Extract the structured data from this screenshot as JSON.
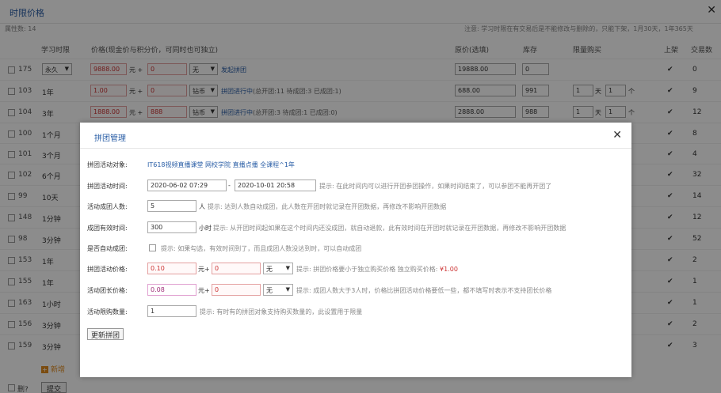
{
  "window": {
    "title": "时限价格"
  },
  "subbar": {
    "count": "属性数: 14",
    "note": "注意: 学习时限在有交易后是不能修改与删除的，只能下架，1月30天，1年365天"
  },
  "header": {
    "duration": "学习时限",
    "price": "价格(现金价与积分价，可同时也可独立)",
    "original": "原价(选填)",
    "stock": "库存",
    "limit": "限量购买",
    "listed": "上架",
    "sales": "交易数"
  },
  "rows": [
    {
      "id": "175",
      "duration_select": "永久",
      "cash": "9888.00",
      "points": "0",
      "points_type": "无",
      "link": "发起拼团",
      "link_extra": "",
      "original": "19888.00",
      "stock": "0",
      "limit_day": "",
      "limit_qty": "",
      "sales": "0"
    },
    {
      "id": "103",
      "duration": "1年",
      "cash": "1.00",
      "points": "0",
      "points_type": "钻币",
      "link": "拼团进行中",
      "link_extra": "(总开团:11 待成团:3 已成团:1)",
      "original": "688.00",
      "stock": "991",
      "limit_day": "1",
      "limit_qty": "1",
      "sales": "9"
    },
    {
      "id": "104",
      "duration": "3年",
      "cash": "1888.00",
      "points": "888",
      "points_type": "钻币",
      "link": "拼团进行中",
      "link_extra": "(总开团:3 待成团:1 已成团:0)",
      "original": "2888.00",
      "stock": "988",
      "limit_day": "1",
      "limit_qty": "1",
      "sales": "12"
    },
    {
      "id": "100",
      "duration": "1个月",
      "sales": "8"
    },
    {
      "id": "101",
      "duration": "3个月",
      "sales": "4"
    },
    {
      "id": "102",
      "duration": "6个月",
      "sales": "32"
    },
    {
      "id": "99",
      "duration": "10天",
      "sales": "14"
    },
    {
      "id": "148",
      "duration": "1分钟",
      "sales": "12"
    },
    {
      "id": "98",
      "duration": "3分钟",
      "sales": "52"
    },
    {
      "id": "153",
      "duration": "1年",
      "sales": "2"
    },
    {
      "id": "155",
      "duration": "1年",
      "sales": "1"
    },
    {
      "id": "163",
      "duration": "1小时",
      "sales": "1"
    },
    {
      "id": "156",
      "duration": "3分钟",
      "sales": "2"
    },
    {
      "id": "159",
      "duration": "3分钟",
      "sales": "3"
    }
  ],
  "common": {
    "yuan_plus": "元 +",
    "day": "天",
    "unit": "个",
    "check": "✔"
  },
  "add_label": "新增",
  "footer": {
    "delete": "删?",
    "submit": "提交"
  },
  "modal": {
    "title": "拼团管理",
    "object_label": "拼团活动对象:",
    "object_value": "IT618视频直播课堂 网校学院 直播点播 全课程^1年",
    "time_label": "拼团活动时间:",
    "time_start": "2020-06-02 07:29",
    "time_sep": "-",
    "time_end": "2020-10-01 20:58",
    "time_tip": "提示: 在此时间内可以进行开团参团操作，如果时间结束了，可以参团不能再开团了",
    "people_label": "活动成团人数:",
    "people_value": "5",
    "people_unit": "人",
    "people_tip": "提示: 达到人数自动成团，此人数在开团时就记录在开团数据，再修改不影响开团数据",
    "valid_label": "成团有效时间:",
    "valid_value": "300",
    "valid_unit": "小时",
    "valid_tip": "提示: 从开团时间起如果在这个时间内还没成团，就自动退款，此有效时间在开团时就记录在开团数据，再修改不影响开团数据",
    "auto_label": "是否自动成团:",
    "auto_tip": "提示: 如果勾选，有效时间到了，而且成团人数没达到时，可以自动成团",
    "price_label": "拼团活动价格:",
    "price_value": "0.10",
    "price_yuan": "元+",
    "price_points": "0",
    "price_type": "无",
    "price_tip": "提示: 拼团价格要小于独立购买价格 独立购买价格:",
    "price_tip_value": "¥1.00",
    "leader_label": "活动团长价格:",
    "leader_value": "0.08",
    "leader_yuan": "元+",
    "leader_points": "0",
    "leader_type": "无",
    "leader_tip": "提示: 成团人数大于3人时，价格比拼团活动价格要低一些，都不填写时表示不支持团长价格",
    "limit_label": "活动限购数量:",
    "limit_value": "1",
    "limit_tip": "提示: 有时有的拼团对象支持购买数量的，此设置用于限量",
    "update_button": "更新拼团"
  }
}
